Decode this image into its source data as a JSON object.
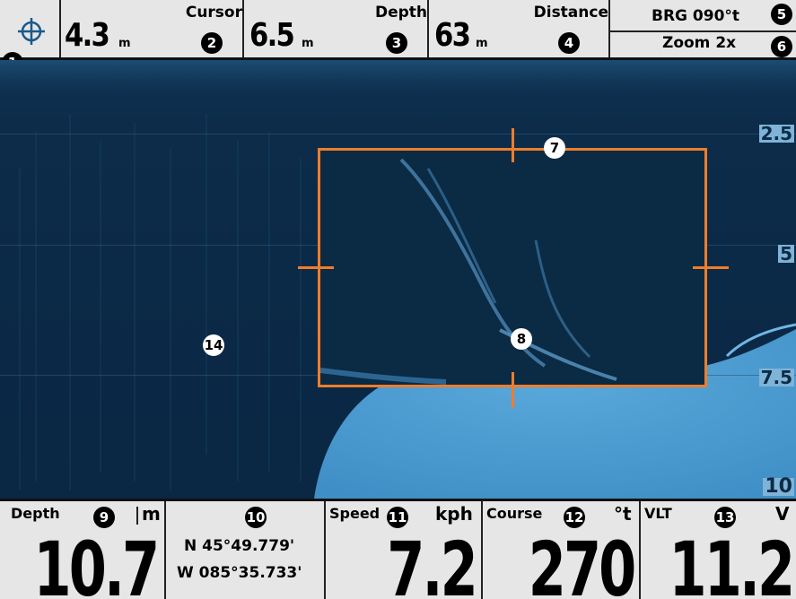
{
  "topbar": {
    "cursor_value": "4.3",
    "cursor_unit": "m",
    "cursor_label": "Cursor",
    "depth_value": "6.5",
    "depth_unit": "m",
    "depth_label": "Depth",
    "distance_value": "63",
    "distance_unit": "m",
    "distance_label": "Distance",
    "bearing": "BRG 090°t",
    "zoom": "Zoom 2x"
  },
  "scale": {
    "ticks": [
      "2.5",
      "5",
      "7.5",
      "10"
    ]
  },
  "callouts": [
    "1",
    "2",
    "3",
    "4",
    "5",
    "6",
    "7",
    "8",
    "9",
    "10",
    "11",
    "12",
    "13",
    "14"
  ],
  "bottombar": {
    "depth_label": "Depth",
    "depth_unit": "m",
    "depth_value": "10.7",
    "lat": "N 45°49.779'",
    "lon": "W 085°35.733'",
    "speed_label": "Speed",
    "speed_unit": "kph",
    "speed_value": "7.2",
    "course_label": "Course",
    "course_unit": "°t",
    "course_value": "270",
    "vlt_label": "VLT",
    "vlt_unit": "V",
    "vlt_value": "11.2"
  },
  "colors": {
    "accent": "#f07d2a",
    "water": "#0b2a45",
    "bottom": "#4f9fd3",
    "panel": "#e6e6e6"
  }
}
